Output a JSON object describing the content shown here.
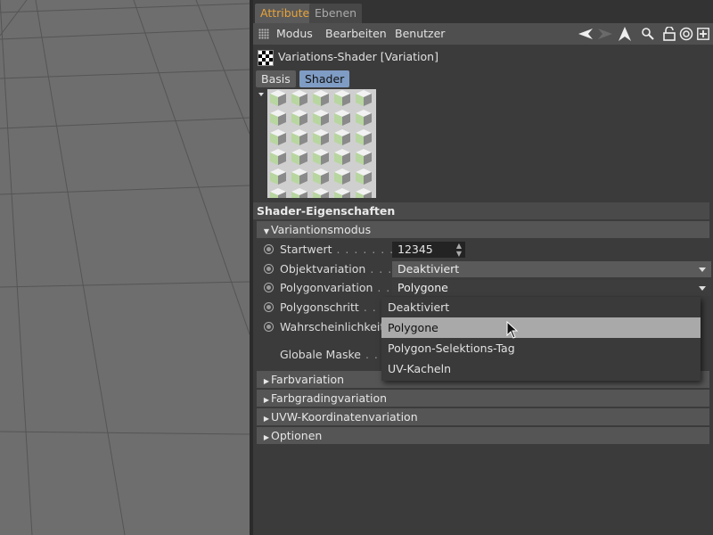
{
  "tabs": [
    {
      "label": "Attribute",
      "active": true
    },
    {
      "label": "Ebenen",
      "active": false
    }
  ],
  "menubar": {
    "items": [
      "Modus",
      "Bearbeiten",
      "Benutzer"
    ],
    "icons": [
      "back-arrow-icon",
      "forward-arrow-icon",
      "up-arrow-icon",
      "search-icon",
      "lock-icon",
      "target-icon",
      "new-panel-icon"
    ]
  },
  "header": {
    "title": "Variations-Shader [Variation]"
  },
  "subtabs": [
    {
      "label": "Basis",
      "active": false
    },
    {
      "label": "Shader",
      "active": true
    }
  ],
  "section_title": "Shader-Eigenschaften",
  "groups": {
    "variationsmodus": "Variantionsmodus",
    "collapsed": [
      "Farbvariation",
      "Farbgradingvariation",
      "UVW-Koordinatenvariation",
      "Optionen"
    ]
  },
  "params": {
    "startwert": {
      "label": "Startwert",
      "dots": " . . . . . . . . .",
      "value": "12345"
    },
    "objektvariation": {
      "label": "Objektvariation",
      "dots": " . . .",
      "value": "Deaktiviert"
    },
    "polygonvariation": {
      "label": "Polygonvariation",
      "dots": " . .",
      "value": "Polygone"
    },
    "polygonschritt": {
      "label": "Polygonschritt",
      "dots": " . . . ."
    },
    "wahrscheinlichkeit": {
      "label": "Wahrscheinlichkeit"
    },
    "globale_maske": {
      "label": "Globale Maske",
      "dots": " . . . ."
    }
  },
  "dropdown": {
    "options": [
      "Deaktiviert",
      "Polygone",
      "Polygon-Selektions-Tag",
      "UV-Kacheln"
    ],
    "hovered": "Polygone"
  },
  "colors": {
    "active_tab_text": "#e8a33a",
    "active_subtab_bg": "#7f9cc4",
    "hover_bg": "#a9a9a9"
  }
}
